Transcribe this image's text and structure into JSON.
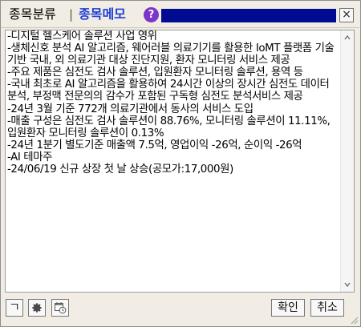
{
  "titlebar": {
    "tab_classification": "종목분류",
    "separator": "|",
    "tab_memo": "종목메모",
    "help_icon": "?",
    "close_icon": "×",
    "band_color": "#000b91",
    "memo_tab_color": "#1d3fd6",
    "help_color": "#7a35c9"
  },
  "memo": {
    "text": "-디지털 헬스케어 솔루션 사업 영위\n-생체신호 분석 AI 알고리즘, 웨어러블 의료기기를 활용한 IoMT 플랫폼 기술 기반 국내, 외 의료기관 대상 진단지원, 환자 모니터링 서비스 제공\n-주요 제품은 심전도 검사 솔루션, 입원환자 모니터링 솔루션, 용역 등\n-국내 최초로 AI 알고리즘을 활용하여 24시간 이상의 장시간 심전도 데이터 분석, 부정맥 전문의의 감수가 포함된 구독형 심전도 분석서비스 제공\n-24년 3월 기준 772개 의료기관에서 동사의 서비스 도입\n-매출 구성은 심전도 검사 솔루션이 88.76%, 모니터링 솔루션이 11.11%, 입원환자 모니터링 솔루션이 0.13%\n-24년 1분기 별도기준 매출액 7.5억, 영업이익 -26억, 순이익 -26억\n-AI 테마주\n-24/06/19 신규 상장 첫 날 상승(공모가:17,000원)"
  },
  "scrollbar": {
    "up_icon": "chevron-up-icon",
    "down_icon": "chevron-down-icon"
  },
  "toolbar": {
    "collapse_label": "ㄱ",
    "settings_icon": "gear-icon",
    "history_icon": "calendar-clock-icon",
    "ok_label": "확인",
    "cancel_label": "취소"
  }
}
